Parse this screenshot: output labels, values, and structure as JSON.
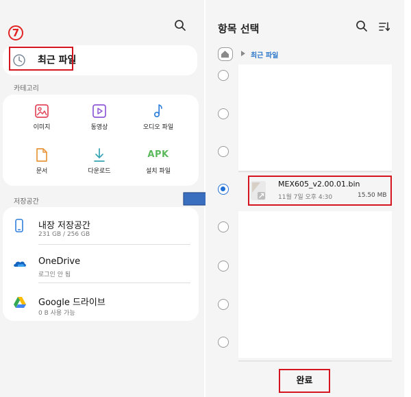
{
  "left": {
    "step_badge": "7",
    "recent_label": "최근 파일",
    "categories_label": "카테고리",
    "categories": [
      {
        "label": "이미지",
        "icon": "image-icon"
      },
      {
        "label": "동영상",
        "icon": "video-icon"
      },
      {
        "label": "오디오 파일",
        "icon": "music-icon"
      },
      {
        "label": "문서",
        "icon": "document-icon"
      },
      {
        "label": "다운로드",
        "icon": "download-icon"
      },
      {
        "label": "설치 파일",
        "icon": "apk-icon",
        "icon_text": "APK"
      }
    ],
    "storage_label": "저장공간",
    "storage": [
      {
        "name": "내장 저장공간",
        "sub": "231 GB / 256 GB",
        "icon": "phone-icon"
      },
      {
        "name": "OneDrive",
        "sub": "로그인 안 됨",
        "icon": "onedrive-icon"
      },
      {
        "name": "Google 드라이브",
        "sub": "0 B 사용 가능",
        "icon": "google-drive-icon"
      }
    ]
  },
  "right": {
    "title": "항목 선택",
    "breadcrumb": "최근 파일",
    "file": {
      "name": "MEX605_v2.00.01.bin",
      "date": "11월 7일 오후 4:30",
      "size": "15.50 MB"
    },
    "done_label": "완료"
  },
  "colors": {
    "highlight": "#d4141f",
    "accent_blue": "#1f6fd6",
    "arrow": "#3a6fbf",
    "apk_green": "#5cb85c",
    "icon_pink": "#e2475b",
    "icon_purple": "#8e58d6",
    "icon_blue": "#2f7fdc",
    "icon_orange": "#e8963b",
    "icon_teal": "#34a3b3"
  }
}
